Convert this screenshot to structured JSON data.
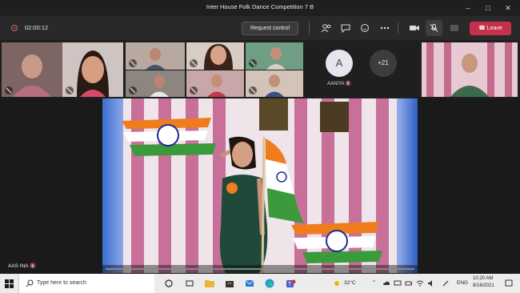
{
  "window": {
    "title": "Inter House Folk Dance Competition 7 B",
    "controls": [
      "minimize-icon",
      "maximize-icon",
      "close-icon"
    ]
  },
  "toolbar": {
    "timer": "02:00:12",
    "request_control_label": "Request control",
    "leave_label": "Leave",
    "leave_color": "#c4314b"
  },
  "participants": {
    "avatar_initial": "A",
    "avatar_name": "AANIYA",
    "overflow_count": "+21"
  },
  "speaker": {
    "name": "AAS INA"
  },
  "taskbar": {
    "search_placeholder": "Type here to search",
    "temperature": "32°C",
    "language": "ENG",
    "time": "10:20 AM",
    "date": "8/16/2021"
  }
}
